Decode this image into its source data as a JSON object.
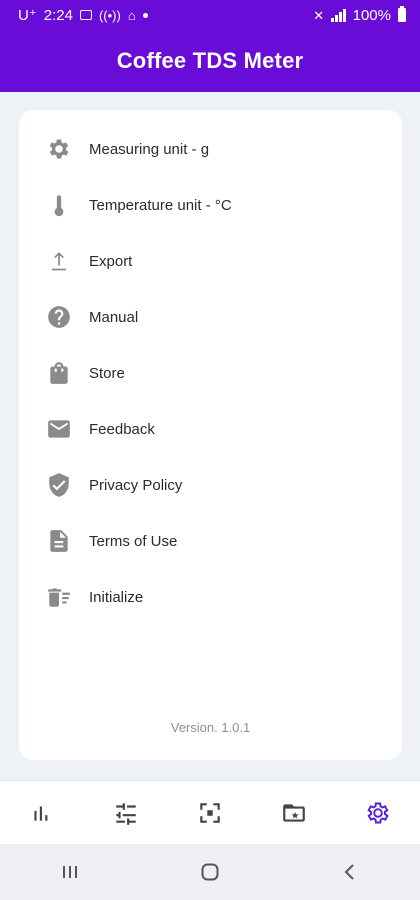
{
  "status_bar": {
    "carrier": "U⁺",
    "time": "2:24",
    "battery_text": "100%"
  },
  "app": {
    "title": "Coffee TDS Meter",
    "brand_color": "#6a0cd8",
    "accent_color": "#5b1fd6"
  },
  "menu": {
    "items": [
      {
        "label": "Measuring unit - g",
        "icon": "gear-icon"
      },
      {
        "label": "Temperature unit - °C",
        "icon": "thermometer-icon"
      },
      {
        "label": "Export",
        "icon": "upload-icon"
      },
      {
        "label": "Manual",
        "icon": "help-icon"
      },
      {
        "label": "Store",
        "icon": "shopping-bag-icon"
      },
      {
        "label": "Feedback",
        "icon": "mail-icon"
      },
      {
        "label": "Privacy Policy",
        "icon": "shield-check-icon"
      },
      {
        "label": "Terms of Use",
        "icon": "document-icon"
      },
      {
        "label": "Initialize",
        "icon": "trash-list-icon"
      }
    ]
  },
  "version": "Version. 1.0.1",
  "bottom_nav": {
    "items": [
      {
        "icon": "bar-chart-icon",
        "active": false
      },
      {
        "icon": "sliders-icon",
        "active": false
      },
      {
        "icon": "scan-icon",
        "active": false
      },
      {
        "icon": "folder-star-icon",
        "active": false
      },
      {
        "icon": "settings-icon",
        "active": true
      }
    ]
  },
  "system_nav": {
    "items": [
      {
        "icon": "recent-apps-icon"
      },
      {
        "icon": "home-icon"
      },
      {
        "icon": "back-icon"
      }
    ]
  }
}
